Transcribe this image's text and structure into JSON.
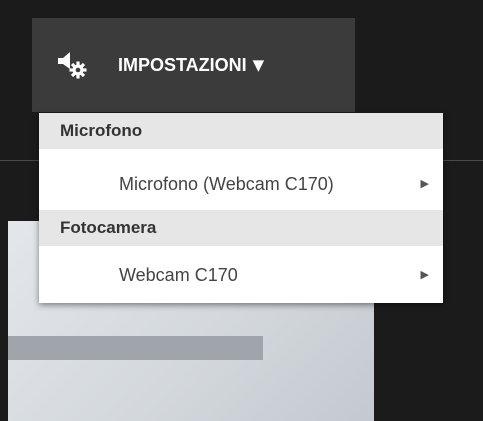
{
  "settings_button": {
    "label": "IMPOSTAZIONI",
    "icon": "speaker-settings-icon",
    "caret": "▼"
  },
  "dropdown": {
    "sections": [
      {
        "header": "Microfono",
        "item": "Microfono (Webcam C170)",
        "arrow": "▶"
      },
      {
        "header": "Fotocamera",
        "item": "Webcam C170",
        "arrow": "▶"
      }
    ]
  },
  "colors": {
    "background": "#1b1b1b",
    "button_bg": "#3b3b3b",
    "section_header_bg": "#e6e6e6",
    "menu_bg": "#ffffff"
  }
}
